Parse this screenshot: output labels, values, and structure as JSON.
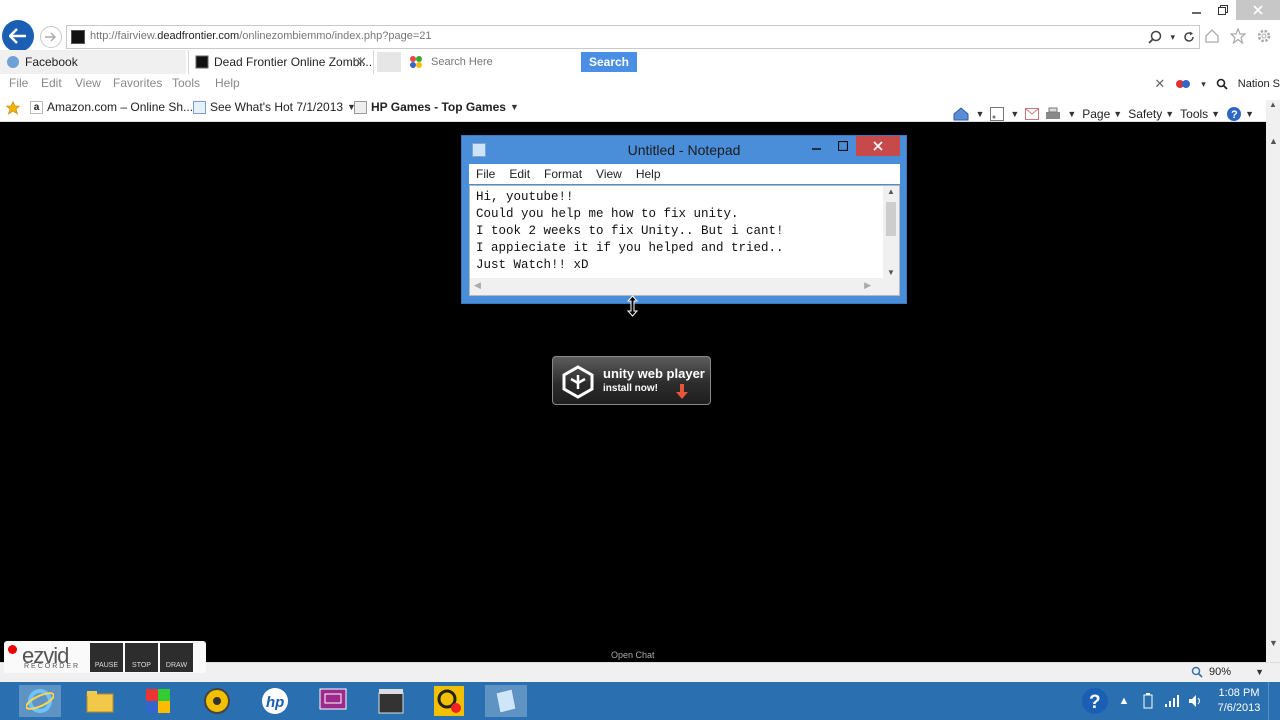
{
  "browser": {
    "url_prefix": "http://fairview.",
    "url_domain": "deadfrontier.com",
    "url_suffix": "/onlinezombiemmo/index.php?page=21",
    "tabs": [
      {
        "label": "Facebook"
      },
      {
        "label": "Dead Frontier Online Zombi..."
      }
    ],
    "search_placeholder": "Search Here",
    "search_button": "Search",
    "menu": [
      "File",
      "Edit",
      "View",
      "Favorites",
      "Tools",
      "Help"
    ],
    "nation_label": "Nation S",
    "favorites": [
      {
        "label": "Amazon.com – Online Sh..."
      },
      {
        "label": "See What's Hot 7/1/2013"
      },
      {
        "label": "HP Games - Top Games"
      }
    ],
    "command_bar": {
      "page": "Page",
      "safety": "Safety",
      "tools": "Tools"
    },
    "zoom": "90%"
  },
  "page": {
    "open_chat": "Open Chat",
    "unity": {
      "title": "unity web player",
      "subtitle": "install now!"
    }
  },
  "notepad": {
    "title": "Untitled - Notepad",
    "menu": [
      "File",
      "Edit",
      "Format",
      "View",
      "Help"
    ],
    "content": "Hi, youtube!!\nCould you help me how to fix unity.\nI took 2 weeks to fix Unity.. But i cant!\nI appieciate it if you helped and tried..\nJust Watch!! xD"
  },
  "ezvid": {
    "logo": "ezvid",
    "sub": "RECORDER",
    "buttons": [
      "PAUSE",
      "STOP",
      "DRAW"
    ]
  },
  "taskbar": {
    "time": "1:08 PM",
    "date": "7/6/2013"
  }
}
